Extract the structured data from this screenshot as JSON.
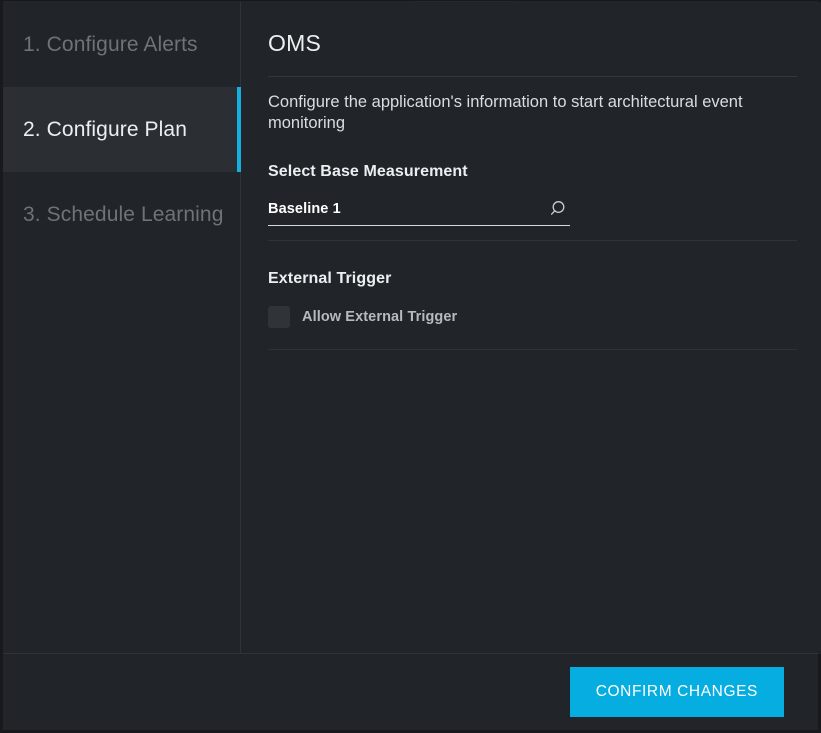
{
  "window": {
    "accent_color": "#16b0e0",
    "button_color": "#05ade0",
    "background_color": "#212428",
    "active_step_background": "#2b2e32"
  },
  "sidebar": {
    "steps": [
      {
        "label": "1. Configure Alerts",
        "active": false
      },
      {
        "label": "2. Configure Plan",
        "active": true
      },
      {
        "label": "3. Schedule Learning",
        "active": false
      }
    ]
  },
  "main": {
    "title": "OMS",
    "description": "Configure the application's information to start architectural event monitoring",
    "base_measurement": {
      "heading": "Select Base Measurement",
      "value": "Baseline 1",
      "placeholder": "Baseline 1",
      "search_icon": "search-icon"
    },
    "external_trigger": {
      "heading": "External Trigger",
      "checkbox_label": "Allow External Trigger",
      "checked": false
    }
  },
  "footer": {
    "confirm_label": "CONFIRM CHANGES"
  }
}
